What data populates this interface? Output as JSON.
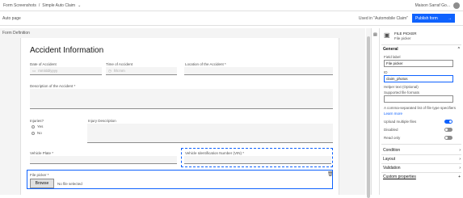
{
  "topbar": {
    "crumbs": [
      "Form Screenshots",
      "/",
      "Simple Auto Claim",
      "⌄"
    ],
    "user": "Maison Sarraf Go..."
  },
  "subbar": {
    "left": "Auto page",
    "used_in": "Used in \"Automobile Claim\"",
    "button": "Publish form"
  },
  "form_definition_label": "Form Definition",
  "form": {
    "title": "Accident Information",
    "fields": {
      "date_label": "Date of Accident",
      "date_placeholder": "mm/dd/yyyy",
      "time_label": "Time of Accident",
      "time_placeholder": "hh:mm",
      "location_label": "Location of the Accident *",
      "description_label": "Description of the Accident *",
      "injuries_label": "Injuries?",
      "yes": "Yes",
      "no": "No",
      "injury_desc_label": "Injury Description",
      "plate_label": "Vehicle Plate *",
      "vin_label": "Vehicle Identification Number (VIN) *",
      "file_label": "File picker *",
      "browse": "Browse",
      "no_file": "No file selected"
    }
  },
  "panel": {
    "type_title": "FILE PICKER",
    "type_sub": "File picker",
    "general": "General",
    "field_label_lbl": "Field label",
    "field_label_val": "File picker",
    "id_lbl": "ID",
    "id_val": "claim_photos",
    "helper_lbl": "Helper text (Optional)",
    "supported_lbl": "Supported file formats",
    "note": "A comma-separated list of file type specifiers",
    "link": "Learn more",
    "upload_multiple": "Upload multiple files",
    "disabled": "Disabled",
    "read_only": "Read only",
    "condition": "Condition",
    "layout": "Layout",
    "validation": "Validation",
    "custom": "Custom properties",
    "upload_multiple_on": true
  }
}
